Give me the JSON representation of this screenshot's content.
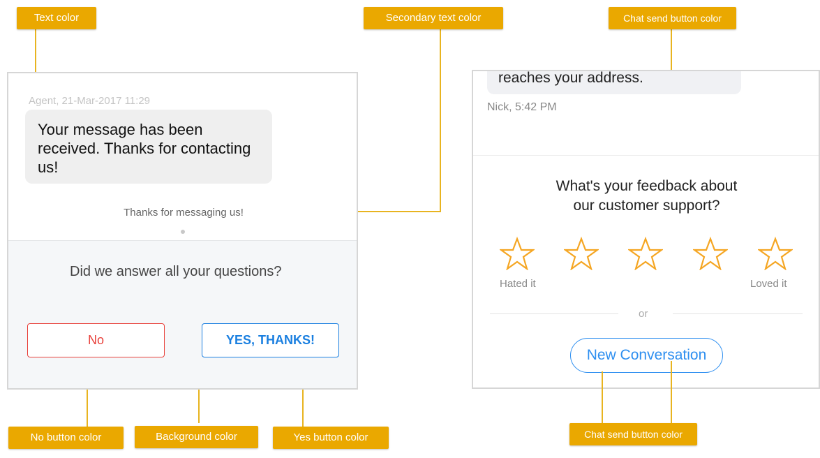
{
  "annotations": {
    "text_color": "Text color",
    "secondary_text_color": "Secondary text color",
    "chat_send_top": "Chat send button color",
    "no_button_color": "No button color",
    "background_color": "Background color",
    "yes_button_color": "Yes button color",
    "chat_send_bottom": "Chat send button color"
  },
  "left": {
    "meta": "Agent, 21-Mar-2017 11:29",
    "message": "Your message has been received. Thanks for contacting us!",
    "secondary": "Thanks for messaging us!",
    "question": "Did we answer all your questions?",
    "no_label": "No",
    "yes_label": "YES, THANKS!"
  },
  "right": {
    "message_tail": "reaches your address.",
    "meta": "Nick, 5:42 PM",
    "question_line1": "What's your feedback about",
    "question_line2": "our customer support?",
    "rating": {
      "value": 0,
      "max": 5
    },
    "low_label": "Hated it",
    "high_label": "Loved it",
    "or_label": "or",
    "new_conversation": "New Conversation"
  },
  "colors": {
    "annotation": "#eaa800",
    "no_button": "#e8403a",
    "yes_button": "#1a7fe0",
    "chat_send": "#2e8ff0",
    "background": "#f5f7f9",
    "star": "#f5a623"
  }
}
